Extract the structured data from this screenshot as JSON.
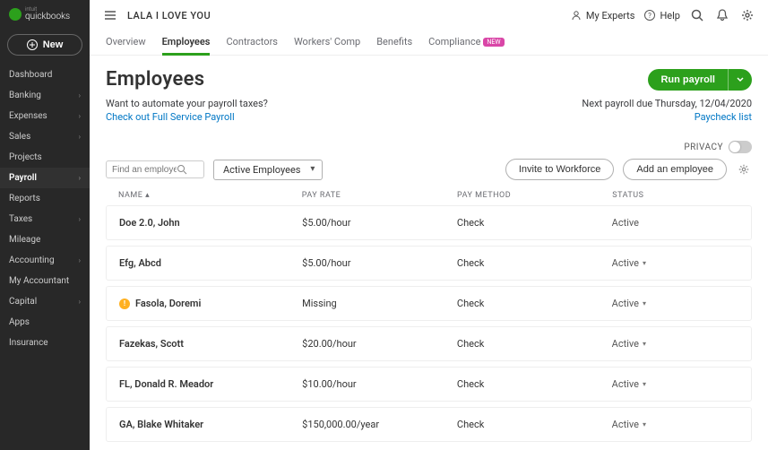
{
  "brand": {
    "intuit": "intuit",
    "name": "quickbooks"
  },
  "new_btn": "New",
  "sidebar": [
    {
      "label": "Dashboard",
      "chev": false,
      "active": false
    },
    {
      "label": "Banking",
      "chev": true,
      "active": false
    },
    {
      "label": "Expenses",
      "chev": true,
      "active": false
    },
    {
      "label": "Sales",
      "chev": true,
      "active": false
    },
    {
      "label": "Projects",
      "chev": false,
      "active": false
    },
    {
      "label": "Payroll",
      "chev": true,
      "active": true
    },
    {
      "label": "Reports",
      "chev": false,
      "active": false
    },
    {
      "label": "Taxes",
      "chev": true,
      "active": false
    },
    {
      "label": "Mileage",
      "chev": false,
      "active": false
    },
    {
      "label": "Accounting",
      "chev": true,
      "active": false
    },
    {
      "label": "My Accountant",
      "chev": false,
      "active": false
    },
    {
      "label": "Capital",
      "chev": true,
      "active": false
    },
    {
      "label": "Apps",
      "chev": false,
      "active": false
    },
    {
      "label": "Insurance",
      "chev": false,
      "active": false
    }
  ],
  "topbar": {
    "company": "LALA I LOVE YOU",
    "experts": "My Experts",
    "help": "Help"
  },
  "tabs": [
    {
      "label": "Overview",
      "active": false
    },
    {
      "label": "Employees",
      "active": true
    },
    {
      "label": "Contractors",
      "active": false
    },
    {
      "label": "Workers' Comp",
      "active": false
    },
    {
      "label": "Benefits",
      "active": false
    },
    {
      "label": "Compliance",
      "active": false,
      "pill": "NEW"
    }
  ],
  "page_title": "Employees",
  "run_payroll": "Run payroll",
  "automate_q": "Want to automate your payroll taxes?",
  "automate_link": "Check out Full Service Payroll",
  "next_payroll": "Next payroll due Thursday, 12/04/2020",
  "paycheck_list": "Paycheck list",
  "privacy": "PRIVACY",
  "search_placeholder": "Find an employee",
  "filter": "Active Employees",
  "invite": "Invite to Workforce",
  "add_emp": "Add an employee",
  "cols": {
    "name": "NAME",
    "rate": "PAY RATE",
    "method": "PAY METHOD",
    "status": "STATUS"
  },
  "rows": [
    {
      "name": "Doe 2.0, John",
      "rate": "$5.00/hour",
      "method": "Check",
      "status": "Active",
      "chev": false,
      "warn": false
    },
    {
      "name": "Efg, Abcd",
      "rate": "$5.00/hour",
      "method": "Check",
      "status": "Active",
      "chev": true,
      "warn": false
    },
    {
      "name": "Fasola, Doremi",
      "rate": "Missing",
      "method": "Check",
      "status": "Active",
      "chev": true,
      "warn": true
    },
    {
      "name": "Fazekas, Scott",
      "rate": "$20.00/hour",
      "method": "Check",
      "status": "Active",
      "chev": true,
      "warn": false
    },
    {
      "name": "FL, Donald R. Meador",
      "rate": "$10.00/hour",
      "method": "Check",
      "status": "Active",
      "chev": true,
      "warn": false
    },
    {
      "name": "GA, Blake Whitaker",
      "rate": "$150,000.00/year",
      "method": "Check",
      "status": "Active",
      "chev": true,
      "warn": false
    }
  ]
}
